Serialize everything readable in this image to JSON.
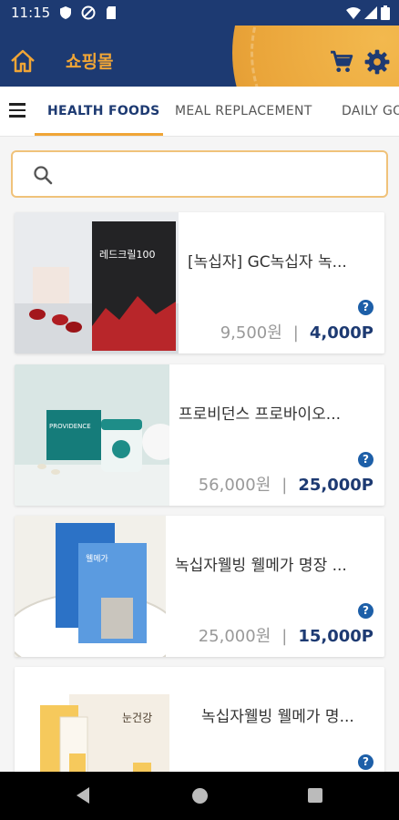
{
  "status_bar": {
    "time": "11:15"
  },
  "app_bar": {
    "title": "쇼핑몰"
  },
  "tabs": [
    {
      "label": "HEALTH FOODS",
      "active": true
    },
    {
      "label": "MEAL REPLACEMENT",
      "active": false
    },
    {
      "label": "DAILY GO",
      "active": false
    }
  ],
  "search": {
    "placeholder": "",
    "value": ""
  },
  "products": [
    {
      "name": "[녹십자] GC녹십자 녹...",
      "price": "9,500원",
      "points": "4,000P",
      "help": "?",
      "box_text": "레드크릴100"
    },
    {
      "name": "프로비던스 프로바이오...",
      "price": "56,000원",
      "points": "25,000P",
      "help": "?",
      "box_text": "PROVIDENCE"
    },
    {
      "name": "녹십자웰빙 웰메가 명장 ...",
      "price": "25,000원",
      "points": "15,000P",
      "help": "?",
      "box_text": "웰메가"
    },
    {
      "name": "녹십자웰빙 웰메가 명...",
      "price": "",
      "points": "",
      "help": "?",
      "box_text": "눈건강"
    }
  ],
  "colors": {
    "primary": "#1d3a72",
    "accent": "#f0a536",
    "help": "#1d5fa8"
  },
  "icons": [
    "home-icon",
    "cart-icon",
    "gear-icon",
    "menu-icon",
    "search-icon",
    "help-icon"
  ]
}
